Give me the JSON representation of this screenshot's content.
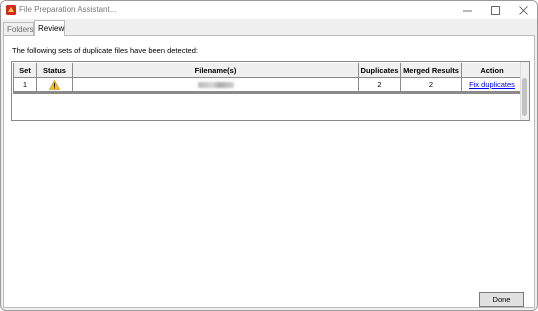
{
  "window": {
    "title": "File Preparation Assistant...",
    "minimize_glyph": "—",
    "maximize_glyph": "☐",
    "close_glyph": "✕",
    "icon": "app-logo-icon"
  },
  "tabs": [
    {
      "label": "Folders",
      "active": false
    },
    {
      "label": "Review",
      "active": true
    }
  ],
  "review": {
    "intro_text": "The following sets of duplicate files have been detected:",
    "columns": [
      "Set",
      "Status",
      "Filename(s)",
      "Duplicates",
      "Merged Results",
      "Action"
    ],
    "rows": [
      {
        "set": "1",
        "status_icon": "warning-icon",
        "filename_redacted": true,
        "duplicates": "2",
        "merged_results": "2",
        "action": "Fix duplicates"
      }
    ]
  },
  "footer": {
    "done_label": "Done"
  },
  "colors": {
    "warning_fill": "#f7c21b",
    "link": "#0000ee",
    "app_icon_red": "#d22b1f"
  }
}
